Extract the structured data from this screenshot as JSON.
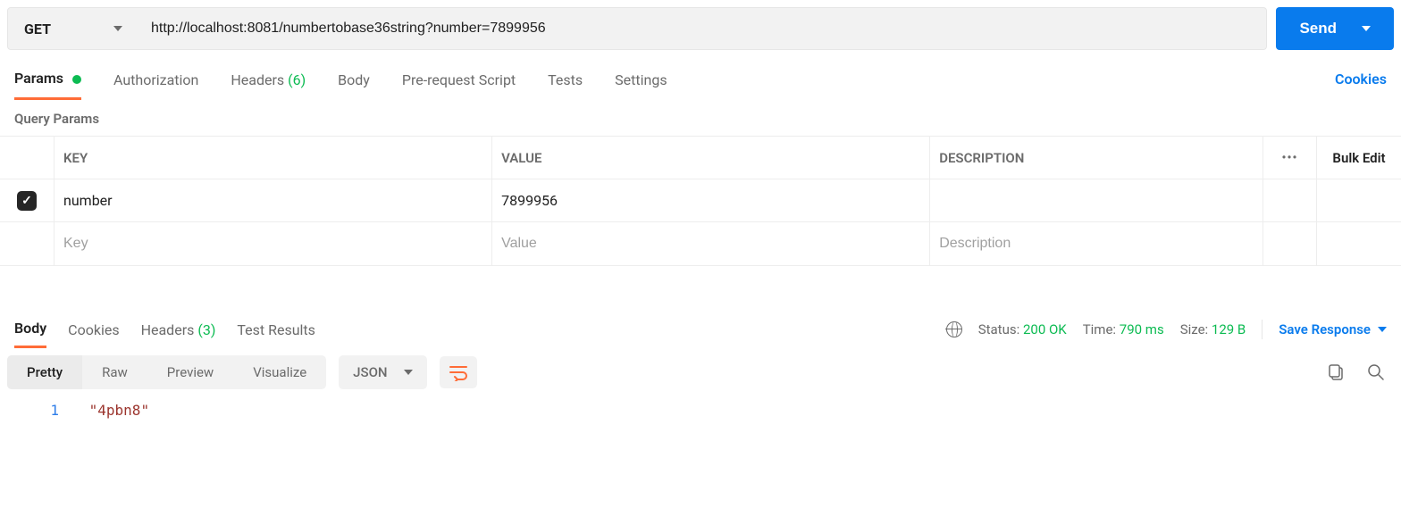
{
  "request": {
    "method": "GET",
    "url": "http://localhost:8081/numbertobase36string?number=7899956",
    "send_label": "Send"
  },
  "tabs": {
    "params_label": "Params",
    "authorization_label": "Authorization",
    "headers_label": "Headers",
    "headers_count": "(6)",
    "body_label": "Body",
    "prerequest_label": "Pre-request Script",
    "tests_label": "Tests",
    "settings_label": "Settings",
    "cookies_link": "Cookies"
  },
  "query_params": {
    "section_label": "Query Params",
    "header_key": "KEY",
    "header_value": "VALUE",
    "header_desc": "DESCRIPTION",
    "bulk_edit": "Bulk Edit",
    "rows": [
      {
        "enabled": true,
        "key": "number",
        "value": "7899956",
        "description": ""
      }
    ],
    "placeholders": {
      "key": "Key",
      "value": "Value",
      "description": "Description"
    }
  },
  "response": {
    "tabs": {
      "body_label": "Body",
      "cookies_label": "Cookies",
      "headers_label": "Headers",
      "headers_count": "(3)",
      "test_results_label": "Test Results"
    },
    "status_label": "Status:",
    "status_value": "200 OK",
    "time_label": "Time:",
    "time_value": "790 ms",
    "size_label": "Size:",
    "size_value": "129 B",
    "save_response": "Save Response",
    "view_tabs": {
      "pretty": "Pretty",
      "raw": "Raw",
      "preview": "Preview",
      "visualize": "Visualize"
    },
    "format": "JSON",
    "body_lines": [
      {
        "n": "1",
        "content": "\"4pbn8\""
      }
    ]
  }
}
